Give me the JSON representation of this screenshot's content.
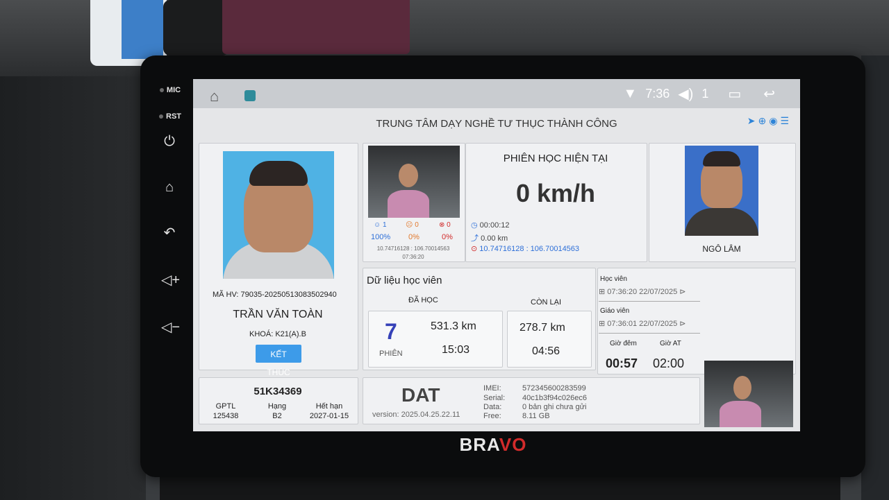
{
  "status": {
    "time": "7:36",
    "notif_count": "1"
  },
  "header": {
    "title": "TRUNG TÂM DẠY NGHỀ TƯ THỤC THÀNH CÔNG"
  },
  "student": {
    "ma_hv": "MÃ HV: 79035-20250513083502940",
    "name": "TRẦN VĂN TOÀN",
    "khoa": "KHOÁ: K21(A).B",
    "end_button": "KẾT THÚC"
  },
  "vehicle": {
    "plate": "51K34369",
    "gptl_label": "GPTL",
    "gptl_value": "125438",
    "hang_label": "Hạng",
    "hang_value": "B2",
    "het_han_label": "Hết hạn",
    "het_han_value": "2027-01-15"
  },
  "face_check": {
    "count_ok": "1",
    "count_warn": "0",
    "count_fail": "0",
    "pct_ok": "100%",
    "pct_warn": "0%",
    "pct_fail": "0%",
    "coords": "10.74716128 : 106.70014563",
    "time": "07:36:20"
  },
  "session": {
    "title": "PHIÊN HỌC HIỆN TẠI",
    "speed": "0 km/h",
    "duration": "00:00:12",
    "distance": "0.00 km",
    "gps": "10.74716128 : 106.70014563"
  },
  "teacher": {
    "name": "NGÔ LÂM"
  },
  "study_data": {
    "title": "Dữ liệu học viên",
    "done_label": "ĐÃ HỌC",
    "remaining_label": "CÒN LẠI",
    "sessions": "7",
    "sessions_label": "PHIÊN",
    "done_km": "531.3 km",
    "done_time": "15:03",
    "remaining_km": "278.7 km",
    "remaining_time": "04:56"
  },
  "login": {
    "student_label": "Học viên",
    "student_time": "07:36:20 22/07/2025",
    "teacher_label": "Giáo viên",
    "teacher_time": "07:36:01 22/07/2025",
    "night_label": "Giờ đêm",
    "night_value": "00:57",
    "at_label": "Giờ AT",
    "at_value": "02:00"
  },
  "device": {
    "name": "DAT",
    "version": "version: 2025.04.25.22.11",
    "imei_label": "IMEI:",
    "imei_value": "572345600283599",
    "serial_label": "Serial:",
    "serial_value": "40c1b3f94c026ec6",
    "data_label": "Data:",
    "data_value": "0 bản ghi chưa gửi",
    "free_label": "Free:",
    "free_value": "8.11 GB"
  },
  "bezel": {
    "mic": "MIC",
    "rst": "RST",
    "brand_a": "BRA",
    "brand_b": "VO"
  }
}
